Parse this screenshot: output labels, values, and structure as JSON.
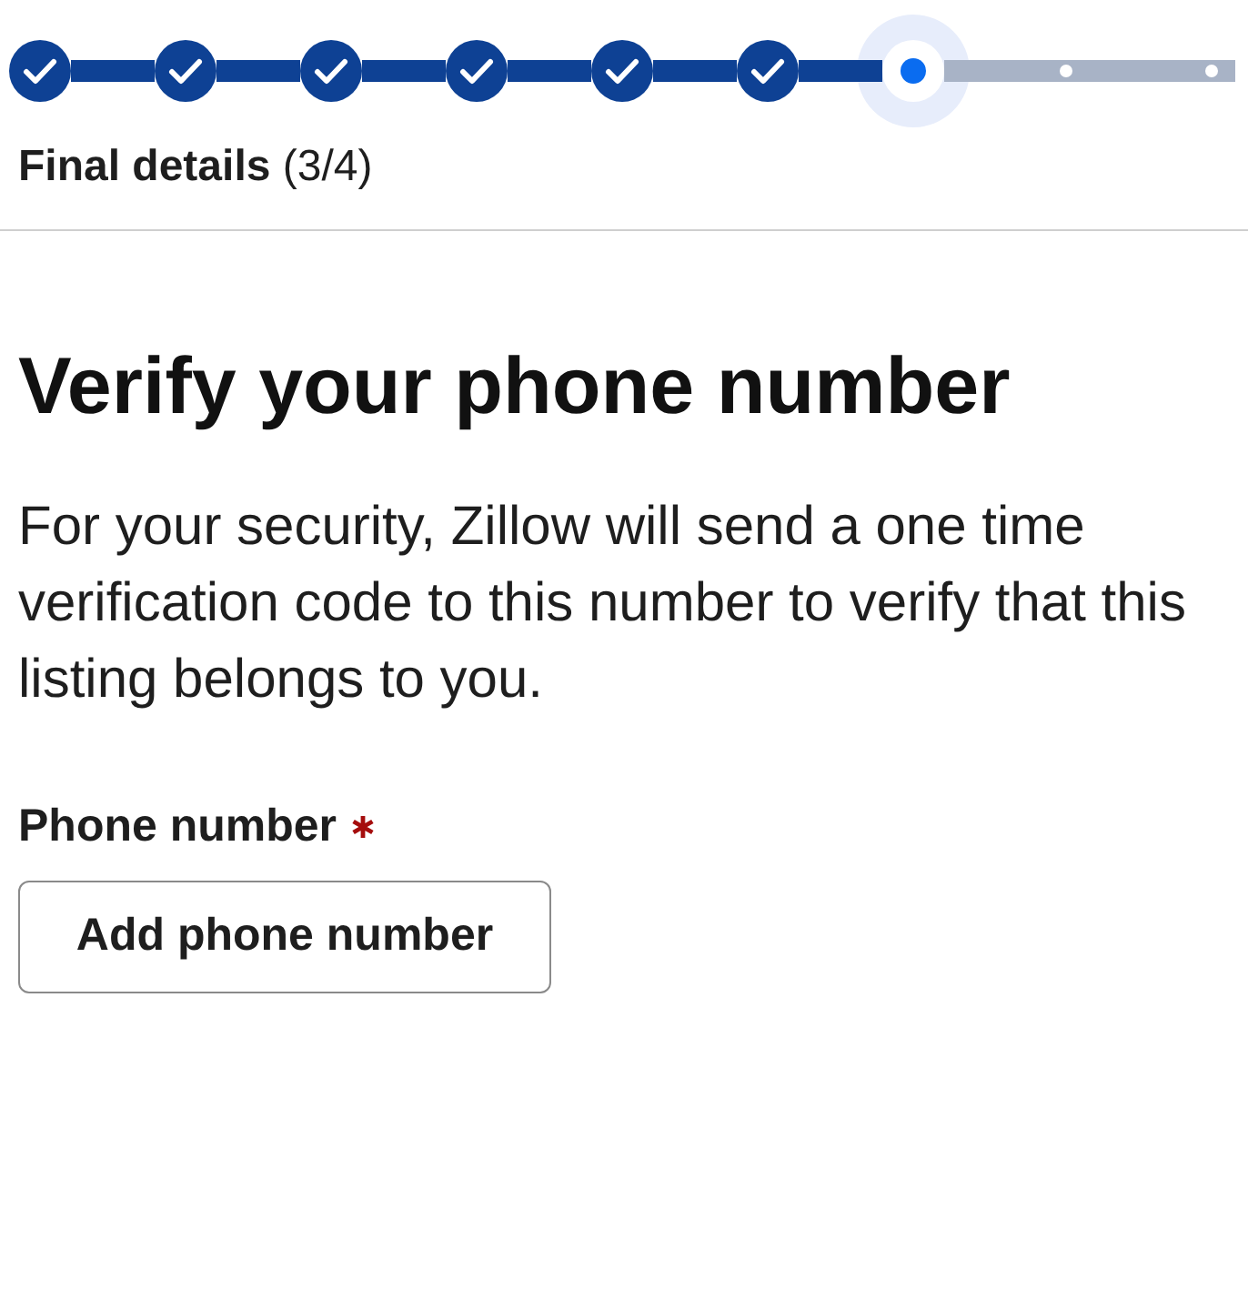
{
  "progress": {
    "steps": [
      {
        "done": true,
        "current": false
      },
      {
        "done": true,
        "current": false
      },
      {
        "done": true,
        "current": false
      },
      {
        "done": true,
        "current": false
      },
      {
        "done": true,
        "current": false
      },
      {
        "done": true,
        "current": false
      },
      {
        "done": false,
        "current": true
      },
      {
        "done": false,
        "current": false
      },
      {
        "done": false,
        "current": false
      }
    ],
    "label": "**Final details** (3/4)"
  },
  "heading": "Verify your phone number",
  "description": "For your security, Zillow will send a one time verification code to this number to verify that this listing belongs to you.",
  "field": {
    "label": "Phone number",
    "required": true,
    "button": "Add phone number"
  }
}
